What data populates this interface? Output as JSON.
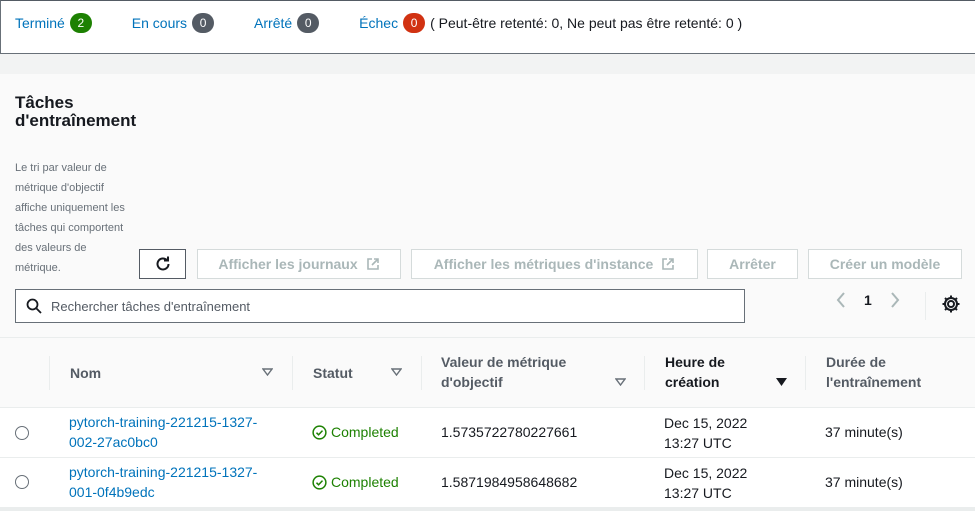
{
  "status_summary": {
    "completed": {
      "label": "Terminé",
      "count": "2"
    },
    "in_progress": {
      "label": "En cours",
      "count": "0"
    },
    "stopped": {
      "label": "Arrêté",
      "count": "0"
    },
    "failed": {
      "label": "Échec",
      "count": "0"
    },
    "retry_note": "( Peut-être retenté: 0, Ne peut pas être retenté: 0 )"
  },
  "panel": {
    "title": "Tâches d'entraînement",
    "description": "Le tri par valeur de métrique d'objectif affiche uniquement les tâches qui comportent des valeurs de métrique."
  },
  "toolbar": {
    "refresh_icon": "refresh-icon",
    "logs_label": "Afficher les journaux",
    "instance_metrics_label": "Afficher les métriques d'instance",
    "stop_label": "Arrêter",
    "create_model_label": "Créer un modèle"
  },
  "search": {
    "placeholder": "Rechercher tâches d'entraînement"
  },
  "pagination": {
    "page": "1"
  },
  "table": {
    "columns": [
      "Nom",
      "Statut",
      "Valeur de métrique d'objectif",
      "Heure de création",
      "Durée de l'entraînement"
    ],
    "rows": [
      {
        "name": "pytorch-training-221215-1327-002-27ac0bc0",
        "status": "Completed",
        "metric": "1.5735722780227661",
        "created_date": "Dec 15, 2022",
        "created_time": "13:27 UTC",
        "duration": "37 minute(s)"
      },
      {
        "name": "pytorch-training-221215-1327-001-0f4b9edc",
        "status": "Completed",
        "metric": "1.5871984958648682",
        "created_date": "Dec 15, 2022",
        "created_time": "13:27 UTC",
        "duration": "37 minute(s)"
      }
    ]
  },
  "colors": {
    "link": "#0073bb",
    "success": "#1d8102",
    "danger": "#d13212",
    "neutral_badge": "#545b64"
  }
}
